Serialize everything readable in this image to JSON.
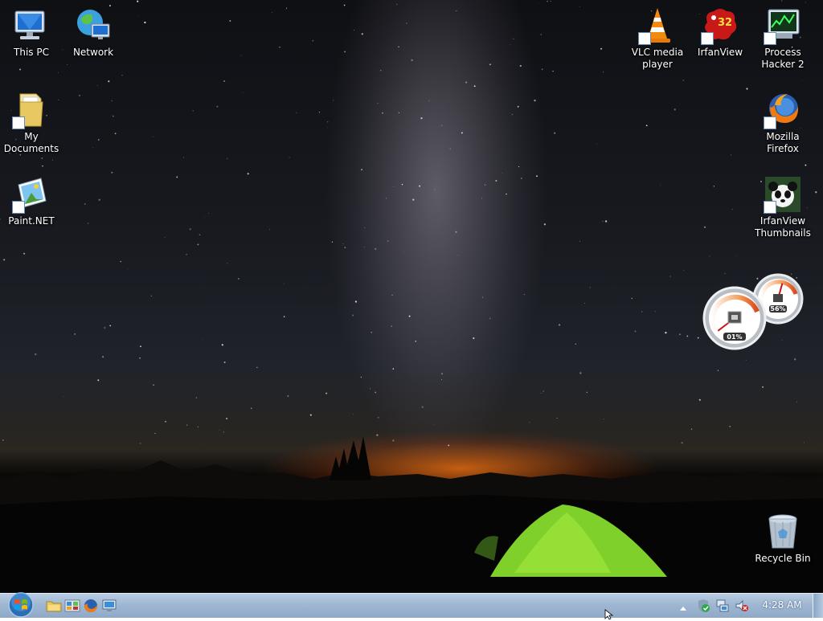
{
  "desktop": {
    "icons_left": [
      {
        "label": "This PC",
        "icon": "computer-icon"
      },
      {
        "label": "Network",
        "icon": "network-globe-icon"
      },
      {
        "label": "My Documents",
        "icon": "documents-folder-icon"
      },
      {
        "label": "Paint.NET",
        "icon": "paint-net-icon"
      }
    ],
    "icons_right": [
      {
        "label": "VLC media player",
        "icon": "vlc-cone-icon"
      },
      {
        "label": "IrfanView",
        "icon": "irfanview-icon",
        "badge": "32"
      },
      {
        "label": "Process Hacker 2",
        "icon": "process-hacker-icon"
      },
      {
        "label": "Mozilla Firefox",
        "icon": "firefox-icon"
      },
      {
        "label": "IrfanView Thumbnails",
        "icon": "irfanview-thumbnails-icon"
      },
      {
        "label": "Recycle Bin",
        "icon": "recycle-bin-icon"
      }
    ]
  },
  "gadget": {
    "cpu_label": "01%",
    "memory_label": "56%",
    "cpu_percent": 1,
    "memory_percent": 56,
    "accent_color": "#d94a1a"
  },
  "taskbar": {
    "start_icon": "windows-start-orb-icon",
    "pinned": [
      {
        "icon": "file-explorer-icon"
      },
      {
        "icon": "control-panel-icon"
      },
      {
        "icon": "firefox-icon"
      },
      {
        "icon": "remote-desktop-icon"
      }
    ],
    "tray": [
      {
        "icon": "show-hidden-icons-arrow-icon"
      },
      {
        "icon": "security-shield-icon"
      },
      {
        "icon": "network-status-icon"
      },
      {
        "icon": "volume-muted-icon"
      }
    ],
    "clock": "4:28 AM",
    "colors": {
      "bar_top": "#b9cde3",
      "bar_bottom": "#8ea9c8"
    }
  }
}
